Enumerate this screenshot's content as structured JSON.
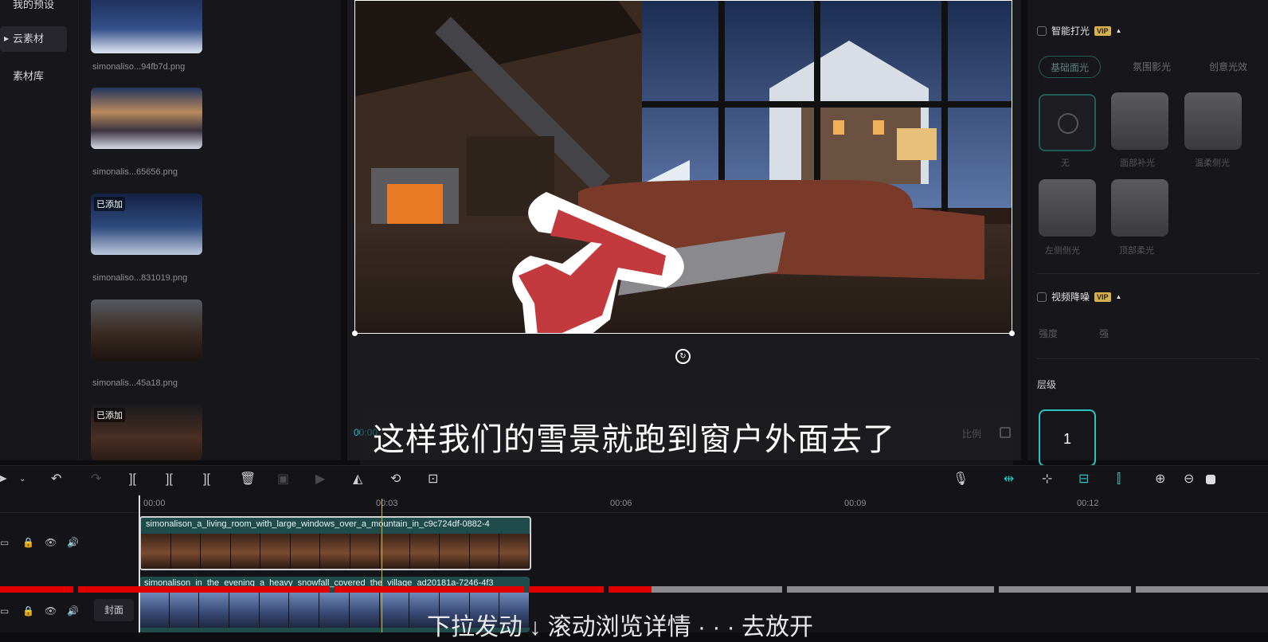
{
  "nav": {
    "my_presets": "我的预设",
    "cloud": "云素材",
    "library": "素材库"
  },
  "assets": [
    {
      "name": "simonaliso...94fb7d.png",
      "added": ""
    },
    {
      "name": "simonalis...65656.png",
      "added": ""
    },
    {
      "name": "simonaliso...831019.png",
      "added": "已添加"
    },
    {
      "name": "simonalis...45a18.png",
      "added": ""
    },
    {
      "name": "",
      "added": "已添加"
    }
  ],
  "player": {
    "subtitle": "这样我们的雪景就跑到窗户外面去了",
    "time": "00:00",
    "ratio": "比例"
  },
  "right": {
    "smart_light": "智能打光",
    "vip": "VIP",
    "pills": [
      "基础面光",
      "氛围影光",
      "创意光效"
    ],
    "face_labels": [
      "无",
      "面部补光",
      "温柔侧光",
      "左侧侧光",
      "顶部柔光"
    ],
    "denoise": "视频降噪",
    "strength": "强度",
    "strong": "强",
    "level": "层级",
    "level_value": "1"
  },
  "ruler": [
    "00:00",
    "00:03",
    "00:06",
    "00:09",
    "00:12"
  ],
  "clips": {
    "clip1": "simonalison_a_living_room_with_large_windows_over_a_mountain_in_c9c724df-0882-4",
    "clip2": "simonalison_in_the_evening_a_heavy_snowfall_covered_the_village_ad20181a-7246-4f3"
  },
  "cover": "封面",
  "bottom_text": "下拉发动 ↓ 滚动浏览详情 · · · 去放开",
  "colors": {
    "accent": "#27c1c1",
    "progress_red": "#e00000",
    "playhead": "#d9b43e"
  }
}
